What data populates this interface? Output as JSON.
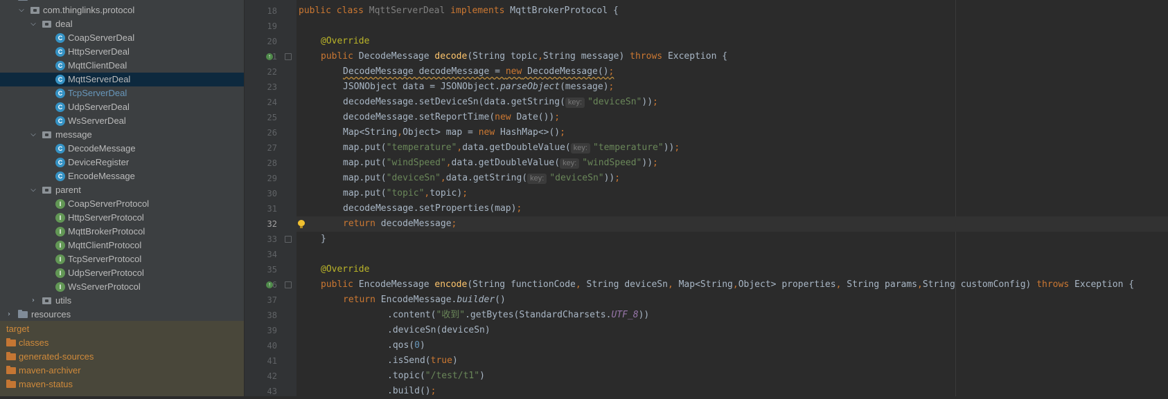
{
  "tree": {
    "package": "com.thinglinks.protocol",
    "deal": {
      "name": "deal",
      "items": [
        "CoapServerDeal",
        "HttpServerDeal",
        "MqttClientDeal",
        "MqttServerDeal",
        "TcpServerDeal",
        "UdpServerDeal",
        "WsServerDeal"
      ]
    },
    "message": {
      "name": "message",
      "items": [
        "DecodeMessage",
        "DeviceRegister",
        "EncodeMessage"
      ]
    },
    "parent": {
      "name": "parent",
      "items": [
        "CoapServerProtocol",
        "HttpServerProtocol",
        "MqttBrokerProtocol",
        "MqttClientProtocol",
        "TcpServerProtocol",
        "UdpServerProtocol",
        "WsServerProtocol"
      ]
    },
    "utils": "utils",
    "resources": "resources",
    "target": {
      "name": "target",
      "items": [
        "classes",
        "generated-sources",
        "maven-archiver",
        "maven-status"
      ]
    },
    "selected": "MqttServerDeal",
    "class_glyph": "C",
    "interface_glyph": "I"
  },
  "editor": {
    "line_numbers": [
      "18",
      "19",
      "20",
      "21",
      "22",
      "23",
      "24",
      "25",
      "26",
      "27",
      "28",
      "29",
      "30",
      "31",
      "32",
      "33",
      "34",
      "35",
      "36",
      "37",
      "38",
      "39",
      "40",
      "41",
      "42",
      "43"
    ],
    "current_line": "32",
    "hint_key": "key:",
    "tokens": {
      "l18": [
        "public",
        "class",
        "MqttServerDeal",
        "implements",
        "MqttBrokerProtocol",
        "{"
      ],
      "l20": "@Override",
      "l21": [
        "public",
        "DecodeMessage ",
        "decode",
        "(String topic",
        ",",
        "String message) ",
        "throws",
        " Exception {"
      ],
      "l22": [
        "DecodeMessage decodeMessage = ",
        "new",
        " DecodeMessage()",
        ";"
      ],
      "l23": [
        "JSONObject data = JSONObject.",
        "parseObject",
        "(message)",
        ";"
      ],
      "l24": [
        "decodeMessage.setDeviceSn(data.getString(",
        "\"deviceSn\"",
        "))",
        ";"
      ],
      "l25": [
        "decodeMessage.setReportTime(",
        "new",
        " Date())",
        ";"
      ],
      "l26": [
        "Map<String",
        ",",
        "Object> map = ",
        "new",
        " HashMap<>()",
        ";"
      ],
      "l27": [
        "map.put(",
        "\"temperature\"",
        ",",
        "data.getDoubleValue(",
        "\"temperature\"",
        "))",
        ";"
      ],
      "l28": [
        "map.put(",
        "\"windSpeed\"",
        ",",
        "data.getDoubleValue(",
        "\"windSpeed\"",
        "))",
        ";"
      ],
      "l29": [
        "map.put(",
        "\"deviceSn\"",
        ",",
        "data.getString(",
        "\"deviceSn\"",
        "))",
        ";"
      ],
      "l30": [
        "map.put(",
        "\"topic\"",
        ",",
        "topic)",
        ";"
      ],
      "l31": [
        "decodeMessage.setProperties(map)",
        ";"
      ],
      "l32": [
        "return",
        " decodeMessage",
        ";"
      ],
      "l33": "}",
      "l35": "@Override",
      "l36": [
        "public",
        " EncodeMessage ",
        "encode",
        "(String functionCode",
        ",",
        " String deviceSn",
        ",",
        " Map<String",
        ",",
        "Object> properties",
        ",",
        " String params",
        ",",
        "String customConfig) ",
        "throws",
        " Exception {"
      ],
      "l37": [
        "return",
        " EncodeMessage.",
        "builder",
        "()"
      ],
      "l38": [
        ".content(",
        "\"收到\"",
        ".getBytes(StandardCharsets.",
        "UTF_8",
        "))"
      ],
      "l39": ".deviceSn(deviceSn)",
      "l40": [
        ".qos(",
        "0",
        ")"
      ],
      "l41": [
        ".isSend(",
        "true",
        ")"
      ],
      "l42": [
        ".topic(",
        "\"/test/t1\"",
        ")"
      ],
      "l43": [
        ".build()",
        ";"
      ]
    }
  },
  "colors": {
    "keyword": "#cc7832",
    "string": "#6a8759",
    "method": "#ffc66d",
    "number": "#6897bb",
    "annotation": "#bbb529",
    "selection": "#0d293e",
    "target_bg": "#49473a"
  }
}
